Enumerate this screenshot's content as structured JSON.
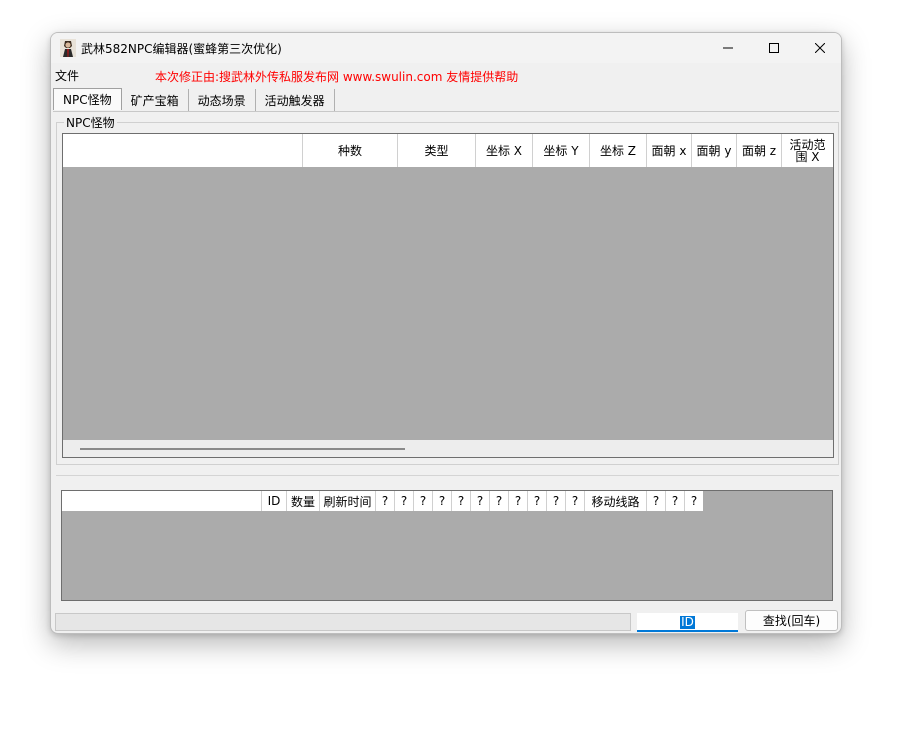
{
  "window": {
    "title": "武林582NPC编辑器(蜜蜂第三次优化)"
  },
  "menu": {
    "file": "文件"
  },
  "notice": "本次修正由:搜武林外传私服发布网 www.swulin.com 友情提供帮助",
  "tabs": [
    "NPC怪物",
    "矿产宝箱",
    "动态场景",
    "活动触发器"
  ],
  "group_label": "NPC怪物",
  "grid1": {
    "columns": [
      "",
      "种数",
      "类型",
      "坐标 X",
      "坐标 Y",
      "坐标 Z",
      "面朝 x",
      "面朝 y",
      "面朝 z",
      "活动范围 X"
    ]
  },
  "grid2": {
    "columns": [
      "",
      "ID",
      "数量",
      "刷新时间",
      "?",
      "?",
      "?",
      "?",
      "?",
      "?",
      "?",
      "?",
      "?",
      "?",
      "?",
      "移动线路",
      "?",
      "?",
      "?"
    ]
  },
  "search": {
    "field_value": "ID",
    "button_label": "查找(回车)"
  },
  "colors": {
    "grid_background": "#ababab",
    "notice_text": "#ff0000",
    "focus_accent": "#0078d7"
  },
  "icons": {
    "app": "app-character-icon",
    "minimize": "minimize-icon",
    "maximize": "maximize-icon",
    "close": "close-icon"
  }
}
